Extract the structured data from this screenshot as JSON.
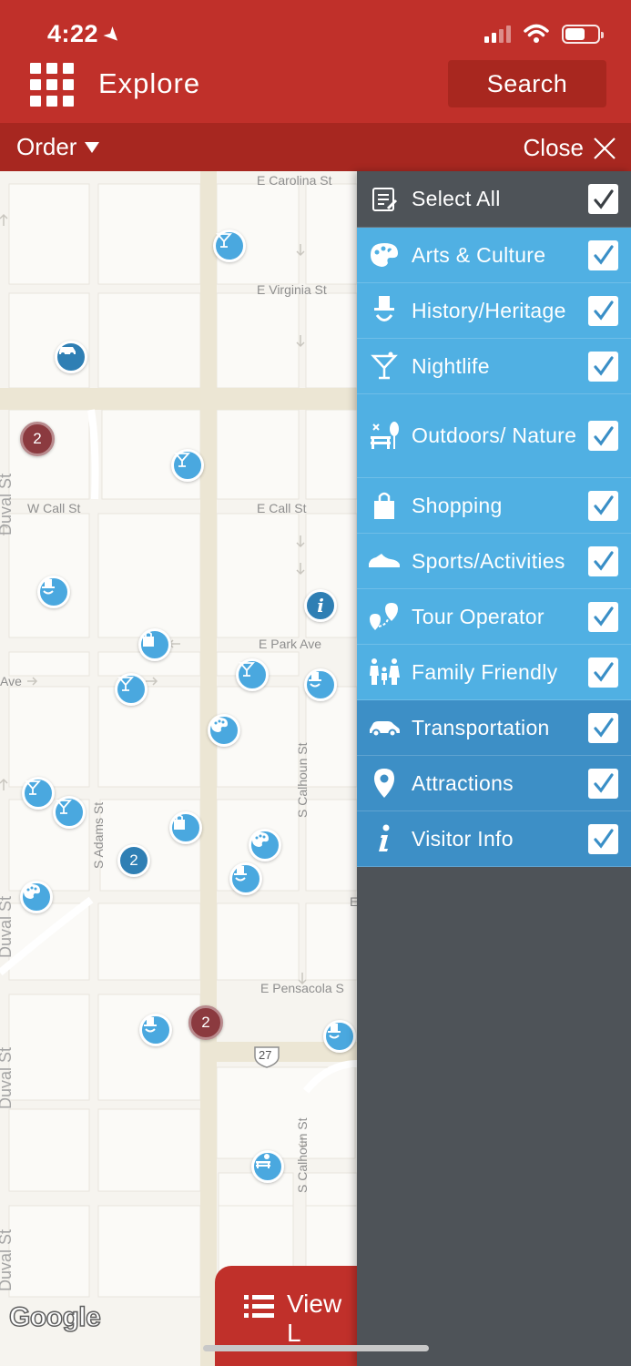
{
  "status": {
    "time": "4:22"
  },
  "header": {
    "title": "Explore",
    "search_label": "Search"
  },
  "subbar": {
    "order_label": "Order",
    "close_label": "Close"
  },
  "map": {
    "streets": {
      "carolina": "E Carolina St",
      "virginia": "E Virginia St",
      "w_call": "W Call St",
      "e_call": "E Call St",
      "park": "E Park Ave",
      "ave": "Ave",
      "adams": "S Adams St",
      "calhoun": "S Calhoun St",
      "calhoun2": "S Calhoun St",
      "pensacola": "E Pensacola S",
      "duval1": "Duval St",
      "duval2": "Duval St",
      "duval3": "Duval St",
      "duval4": "Duval St",
      "e_mark": "E"
    },
    "route_shield": "27",
    "clusters": [
      "2",
      "2",
      "2"
    ],
    "attribution": "Google"
  },
  "view_list_label": "View L",
  "filters": {
    "select_all": {
      "label": "Select All",
      "checked": true,
      "icon": "list-edit-icon"
    },
    "items": [
      {
        "label": "Arts & Culture",
        "icon": "palette-icon",
        "checked": true,
        "shade": "light"
      },
      {
        "label": "History/Heritage",
        "icon": "top-hat-icon",
        "checked": true,
        "shade": "light"
      },
      {
        "label": "Nightlife",
        "icon": "martini-icon",
        "checked": true,
        "shade": "light"
      },
      {
        "label": "Outdoors/ Nature",
        "icon": "park-bench-icon",
        "checked": true,
        "shade": "light"
      },
      {
        "label": "Shopping",
        "icon": "shopping-bag-icon",
        "checked": true,
        "shade": "light"
      },
      {
        "label": "Sports/Activities",
        "icon": "sneaker-icon",
        "checked": true,
        "shade": "light"
      },
      {
        "label": "Tour Operator",
        "icon": "tour-pin-icon",
        "checked": true,
        "shade": "light"
      },
      {
        "label": "Family Friendly",
        "icon": "family-icon",
        "checked": true,
        "shade": "light"
      },
      {
        "label": "Transportation",
        "icon": "car-icon",
        "checked": true,
        "shade": "dark"
      },
      {
        "label": "Attractions",
        "icon": "location-pin-icon",
        "checked": true,
        "shade": "dark"
      },
      {
        "label": "Visitor Info",
        "icon": "info-icon",
        "checked": true,
        "shade": "dark"
      }
    ]
  },
  "colors": {
    "header": "#c0302a",
    "subbar": "#a72720",
    "panel_light": "#50b0e3",
    "panel_dark": "#3d8fc6",
    "panel_bg": "#4e5358",
    "check": "#3a8fc7"
  }
}
